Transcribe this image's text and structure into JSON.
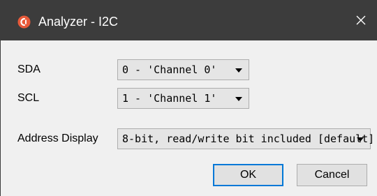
{
  "window": {
    "title": "Analyzer - I2C",
    "app_icon": "logic-analyzer-logo-icon",
    "close_icon": "close-icon"
  },
  "form": {
    "sda": {
      "label": "SDA",
      "value": "0 - 'Channel 0'"
    },
    "scl": {
      "label": "SCL",
      "value": "1 - 'Channel 1'"
    },
    "address_display": {
      "label": "Address Display",
      "value": "8-bit, read/write bit included [default]"
    }
  },
  "buttons": {
    "ok_label": "OK",
    "cancel_label": "Cancel"
  },
  "colors": {
    "titlebar": "#3c3c3c",
    "dialog_background": "#f0f0f0",
    "focus_border": "#0078d7",
    "logo": "#e85a3a"
  }
}
